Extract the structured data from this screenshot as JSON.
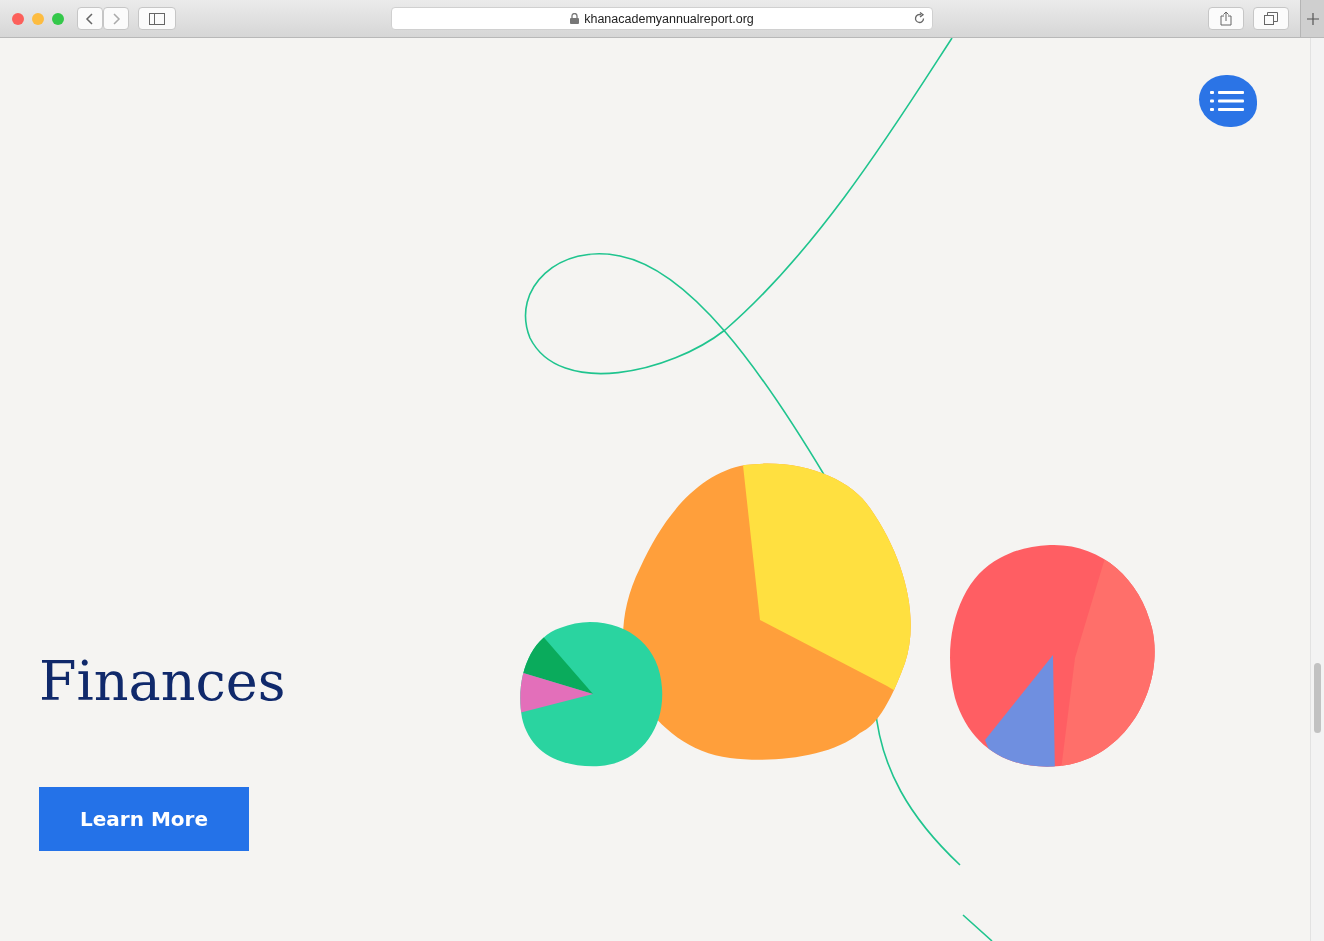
{
  "browser": {
    "url": "khanacademyannualreport.org"
  },
  "page": {
    "heading": "Finances",
    "button": "Learn More"
  }
}
